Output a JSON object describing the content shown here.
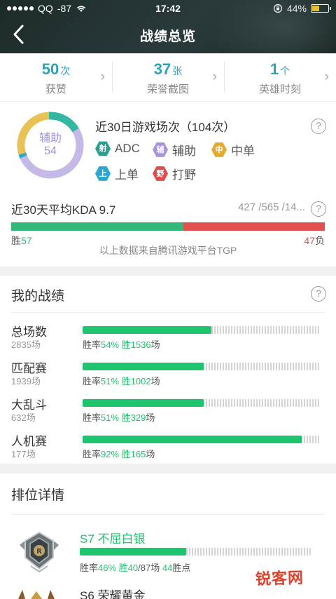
{
  "status_bar": {
    "carrier": "QQ",
    "signal": "-87",
    "time": "17:42",
    "battery": "44%"
  },
  "nav": {
    "title": "战绩总览",
    "back_icon": "chevron-left-icon"
  },
  "stats": [
    {
      "value": "50",
      "unit": "次",
      "label": "获赞"
    },
    {
      "value": "37",
      "unit": "张",
      "label": "荣誉截图"
    },
    {
      "value": "1",
      "unit": "个",
      "label": "英雄时刻"
    }
  ],
  "games": {
    "title": "近30日游戏场次（104次）",
    "donut_role": "辅助",
    "donut_value": "54",
    "segments": [
      {
        "role": "辅助",
        "value": 54,
        "color": "#c6b9e8"
      },
      {
        "role": "ADC",
        "value": 18,
        "color": "#34b7a2"
      },
      {
        "role": "中单",
        "value": 30,
        "color": "#e8c254"
      },
      {
        "role": "上单",
        "value": 2,
        "color": "#2ba7d2"
      }
    ],
    "roles": [
      {
        "icon": "射",
        "label": "ADC",
        "color": "#2a9e8f"
      },
      {
        "icon": "辅",
        "label": "辅助",
        "color": "#a896d8"
      },
      {
        "icon": "中",
        "label": "中单",
        "color": "#e3aa2f"
      },
      {
        "icon": "上",
        "label": "上单",
        "color": "#2ba7d2"
      },
      {
        "icon": "野",
        "label": "打野",
        "color": "#e24b4b"
      }
    ]
  },
  "kda": {
    "title": "近30天平均KDA 9.7",
    "stats": "427 /565 /14...",
    "win_label": "胜",
    "win_count": "57",
    "lose_count": "47",
    "lose_label": "负",
    "win_ratio": 0.548,
    "source": "以上数据来自腾讯游戏平台TGP"
  },
  "my_record": {
    "title": "我的战绩",
    "rows": [
      {
        "name": "总场数",
        "count": "2835场",
        "rate_label": "胜率",
        "rate": "54%",
        "wins_label": "胜",
        "wins": "1536",
        "wins_unit": "场",
        "ratio": 0.54
      },
      {
        "name": "匹配赛",
        "count": "1939场",
        "rate_label": "胜率",
        "rate": "51%",
        "wins_label": "胜",
        "wins": "1002",
        "wins_unit": "场",
        "ratio": 0.51
      },
      {
        "name": "大乱斗",
        "count": "632场",
        "rate_label": "胜率",
        "rate": "51%",
        "wins_label": "胜",
        "wins": "329",
        "wins_unit": "场",
        "ratio": 0.51
      },
      {
        "name": "人机赛",
        "count": "177场",
        "rate_label": "胜率",
        "rate": "92%",
        "wins_label": "胜",
        "wins": "165",
        "wins_unit": "场",
        "ratio": 0.92
      }
    ]
  },
  "ranked": {
    "title": "排位详情",
    "current": {
      "name": "S7 不屈白银",
      "rate_label": "胜率",
      "rate": "46%",
      "wins_label": "胜",
      "wins": "40",
      "total": "/87场",
      "points": "44",
      "points_label": "胜点",
      "ratio": 0.46
    },
    "previous": {
      "name": "S6 荣耀黄金"
    }
  },
  "watermark": "锐客网"
}
